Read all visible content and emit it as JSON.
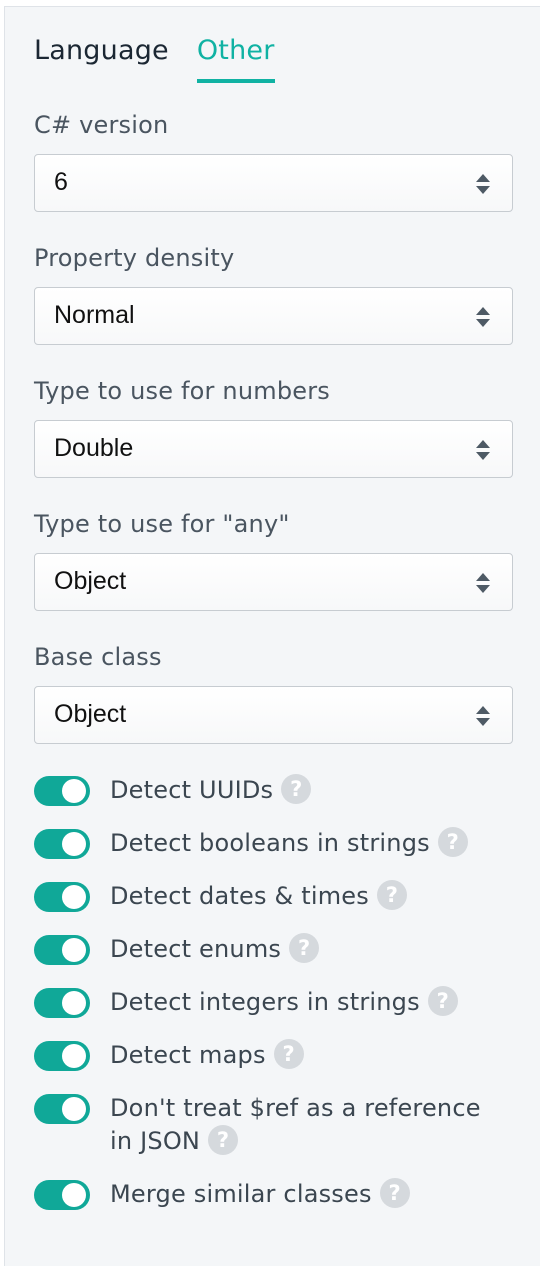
{
  "tabs": [
    {
      "label": "Language",
      "active": false
    },
    {
      "label": "Other",
      "active": true
    }
  ],
  "fields": [
    {
      "label": "C# version",
      "value": "6"
    },
    {
      "label": "Property density",
      "value": "Normal"
    },
    {
      "label": "Type to use for numbers",
      "value": "Double"
    },
    {
      "label": "Type to use for \"any\"",
      "value": "Object"
    },
    {
      "label": "Base class",
      "value": "Object"
    }
  ],
  "toggles": [
    {
      "label": "Detect UUIDs",
      "on": true,
      "help": "?"
    },
    {
      "label": "Detect booleans in strings",
      "on": true,
      "help": "?"
    },
    {
      "label": "Detect dates & times",
      "on": true,
      "help": "?"
    },
    {
      "label": "Detect enums",
      "on": true,
      "help": "?"
    },
    {
      "label": "Detect integers in strings",
      "on": true,
      "help": "?"
    },
    {
      "label": "Detect maps",
      "on": true,
      "help": "?"
    },
    {
      "label": "Don't treat $ref as a reference in JSON",
      "on": true,
      "help": "?"
    },
    {
      "label": "Merge similar classes",
      "on": true,
      "help": "?"
    }
  ],
  "colors": {
    "accent": "#10b2a3",
    "switch_on": "#10a898",
    "help_icon": "#d5d9dd",
    "panel_bg": "#f4f6f8"
  }
}
